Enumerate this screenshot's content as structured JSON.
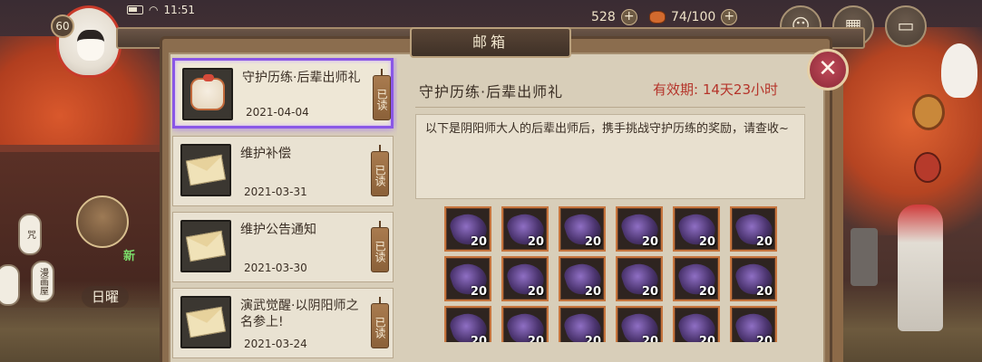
{
  "status_bar": {
    "time": "11:51"
  },
  "player": {
    "level": "60"
  },
  "hud": {
    "coins": "528",
    "stamina": "74/100",
    "plus_symbol": "+"
  },
  "background": {
    "lantern_1": "咒",
    "lantern_2": "漫画屋",
    "sign_text": "日曜",
    "new_badge": "新"
  },
  "dialog": {
    "title": "邮箱",
    "close_symbol": "✕"
  },
  "mail_list": [
    {
      "title": "守护历练·后辈出师礼",
      "date": "2021-04-04",
      "status": "已读",
      "thumb": "gift-icon"
    },
    {
      "title": "维护补偿",
      "date": "2021-03-31",
      "status": "已读",
      "thumb": "envelope-icon"
    },
    {
      "title": "维护公告通知",
      "date": "2021-03-30",
      "status": "已读",
      "thumb": "envelope-icon"
    },
    {
      "title": "演武觉醒·以阴阳师之名参上!",
      "date": "2021-03-24",
      "status": "已读",
      "thumb": "envelope-icon"
    }
  ],
  "detail": {
    "title": "守护历练·后辈出师礼",
    "expiry": "有效期: 14天23小时",
    "body": "以下是阴阳师大人的后辈出师后，携手挑战守护历练的奖励，请查收~"
  },
  "rewards": {
    "count_label": "20",
    "rows_visible": 3,
    "cols": 6
  },
  "colors": {
    "selected_outline": "#8a57e6",
    "expiry_red": "#b5342a",
    "reward_border": "#c7753e"
  }
}
